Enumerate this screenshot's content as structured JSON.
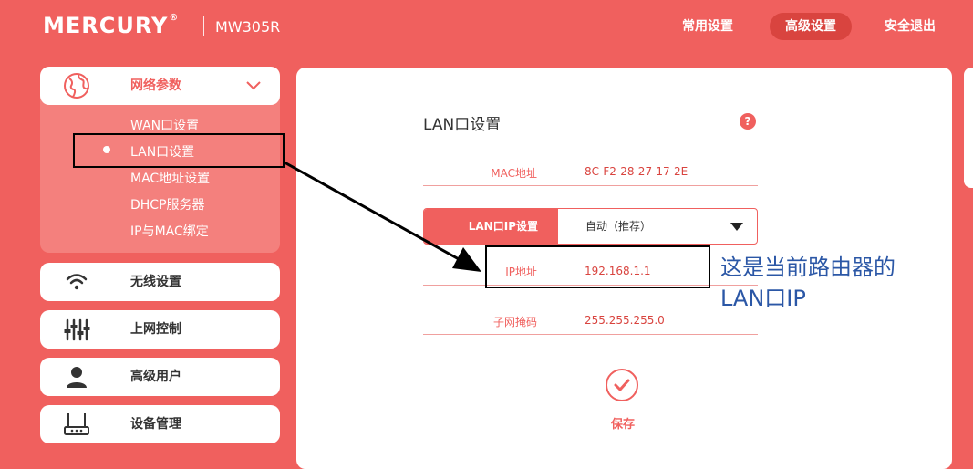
{
  "header": {
    "brand": "MERCURY",
    "brand_mark": "®",
    "model": "MW305R",
    "nav": {
      "common": "常用设置",
      "advanced": "高级设置",
      "logout": "安全退出"
    }
  },
  "sidebar": {
    "network": {
      "label": "网络参数",
      "icon": "globe-icon",
      "items": [
        "WAN口设置",
        "LAN口设置",
        "MAC地址设置",
        "DHCP服务器",
        "IP与MAC绑定"
      ],
      "selected": "LAN口设置"
    },
    "groups": [
      {
        "label": "无线设置",
        "icon": "wifi-icon"
      },
      {
        "label": "上网控制",
        "icon": "sliders-icon"
      },
      {
        "label": "高级用户",
        "icon": "user-icon"
      },
      {
        "label": "设备管理",
        "icon": "router-icon"
      }
    ]
  },
  "main": {
    "title": "LAN口设置",
    "help_icon": "?",
    "mac": {
      "label": "MAC地址",
      "value": "8C-F2-28-27-17-2E"
    },
    "lan_ip_setting": {
      "label": "LAN口IP设置",
      "value": "自动（推荐）"
    },
    "ip": {
      "label": "IP地址",
      "value": "192.168.1.1"
    },
    "mask": {
      "label": "子网掩码",
      "value": "255.255.255.0"
    },
    "save": "保存"
  },
  "annotation": {
    "line1": "这是当前路由器的",
    "line2": "LAN口IP"
  },
  "colors": {
    "accent": "#f0605e",
    "accent_dark": "#d9443f",
    "annotation": "#2b57a6"
  }
}
